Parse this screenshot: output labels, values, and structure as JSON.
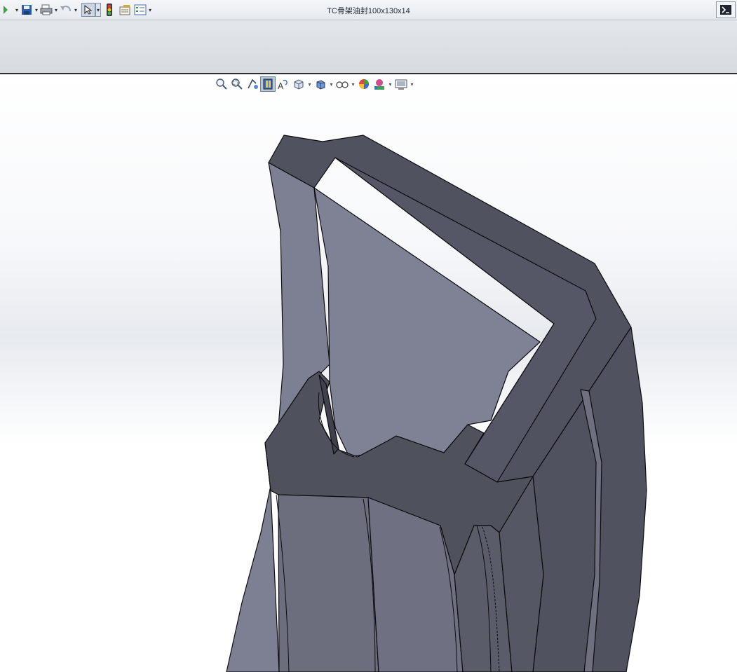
{
  "window": {
    "title": "TC骨架油封100x130x14"
  },
  "quick_access": {
    "items": [
      "new-icon",
      "save-icon",
      "print-icon",
      "undo-icon",
      "select-icon",
      "rebuild-icon",
      "file-properties-icon",
      "options-icon"
    ]
  },
  "heads_up_toolbar": {
    "items": [
      "zoom-to-fit-icon",
      "zoom-to-area-icon",
      "previous-view-icon",
      "section-view-icon",
      "dynamic-annotation-icon",
      "view-orientation-icon",
      "display-style-icon",
      "hide-show-items-icon",
      "edit-appearance-icon",
      "apply-scene-icon",
      "view-settings-icon"
    ]
  },
  "colors": {
    "face_dark": "#515360",
    "face_mid": "#6e7080",
    "face_light": "#808496",
    "edge": "#0b0b0e"
  }
}
